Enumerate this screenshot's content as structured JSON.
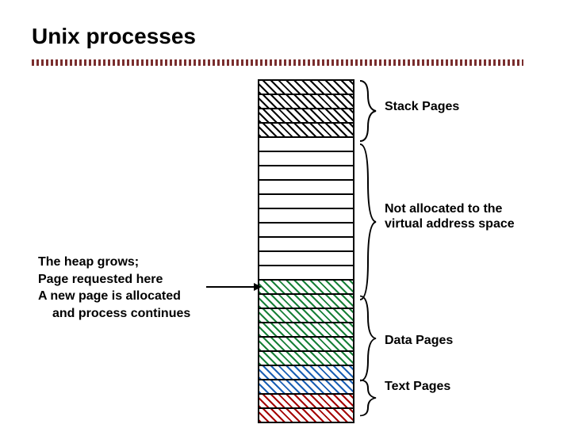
{
  "title": "Unix processes",
  "labels": {
    "stack": "Stack Pages",
    "notalloc1": "Not allocated to the",
    "notalloc2": "virtual address space",
    "data": "Data Pages",
    "text": "Text Pages"
  },
  "left": {
    "l1": "The heap grows;",
    "l2": "Page requested here",
    "l3": "A new page is allocated",
    "l4": "and process continues"
  },
  "colors": {
    "stack": "#000000",
    "newpage": "#188038",
    "data": "#1a5fb4",
    "text_top": "#1a5fb4",
    "text_mid": "#a40000",
    "text_bot": "#a40000"
  },
  "memory_rows": [
    {
      "region": "stack",
      "hatched": true,
      "color_key": "stack"
    },
    {
      "region": "stack",
      "hatched": true,
      "color_key": "stack"
    },
    {
      "region": "stack",
      "hatched": true,
      "color_key": "stack"
    },
    {
      "region": "stack",
      "hatched": true,
      "color_key": "stack"
    },
    {
      "region": "free",
      "hatched": false
    },
    {
      "region": "free",
      "hatched": false
    },
    {
      "region": "free",
      "hatched": false
    },
    {
      "region": "free",
      "hatched": false
    },
    {
      "region": "free",
      "hatched": false
    },
    {
      "region": "free",
      "hatched": false
    },
    {
      "region": "free",
      "hatched": false
    },
    {
      "region": "free",
      "hatched": false
    },
    {
      "region": "free",
      "hatched": false
    },
    {
      "region": "free",
      "hatched": false
    },
    {
      "region": "newpage",
      "hatched": true,
      "color_key": "newpage"
    },
    {
      "region": "data",
      "hatched": true,
      "color_key": "newpage"
    },
    {
      "region": "data",
      "hatched": true,
      "color_key": "newpage"
    },
    {
      "region": "data",
      "hatched": true,
      "color_key": "newpage"
    },
    {
      "region": "data",
      "hatched": true,
      "color_key": "newpage"
    },
    {
      "region": "data",
      "hatched": true,
      "color_key": "newpage"
    },
    {
      "region": "data",
      "hatched": true,
      "color_key": "data"
    },
    {
      "region": "text",
      "hatched": true,
      "color_key": "text_top"
    },
    {
      "region": "text",
      "hatched": true,
      "color_key": "text_mid"
    },
    {
      "region": "text",
      "hatched": true,
      "color_key": "text_bot"
    }
  ]
}
